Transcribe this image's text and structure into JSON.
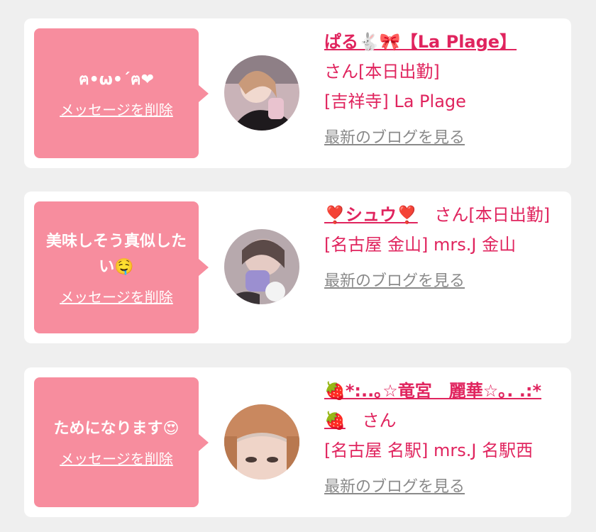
{
  "cards": [
    {
      "message": "ฅ•ω•´ฅ❤︎",
      "delete_label": "メッセージを削除",
      "name": "ぱる🐇🎀【La Plage】",
      "status": "さん[本日出勤]",
      "shop": "[吉祥寺] La Plage",
      "blog_label": "最新のブログを見る",
      "avatar_icon": "avatar-photo"
    },
    {
      "message": "美味しそう真似したい🤤",
      "delete_label": "メッセージを削除",
      "name": "❣️シュウ❣️",
      "status": "さん[本日出勤]",
      "shop": "[名古屋 金山] mrs.J 金山",
      "blog_label": "最新のブログを見る",
      "avatar_icon": "avatar-photo"
    },
    {
      "message": "ためになります😍",
      "delete_label": "メッセージを削除",
      "name": "🍓*:..｡☆竜宮　麗華☆｡. .:*🍓",
      "status": "さん",
      "shop": "[名古屋 名駅] mrs.J 名駅西",
      "blog_label": "最新のブログを見る",
      "avatar_icon": "avatar-photo"
    }
  ],
  "colors": {
    "bubble": "#f78d9e",
    "accent": "#e0245e",
    "link_gray": "#8a8a8a",
    "background": "#efefef"
  }
}
